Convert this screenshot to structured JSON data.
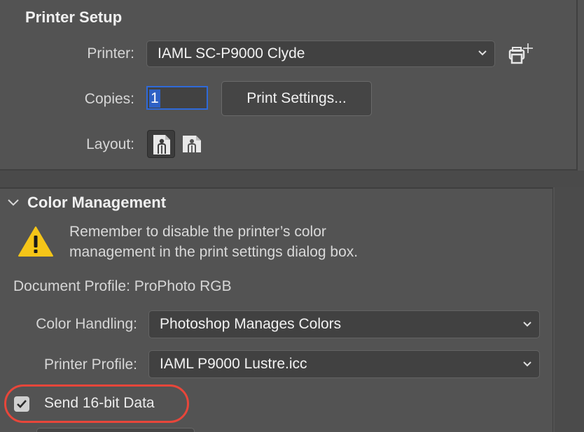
{
  "printer_setup": {
    "title": "Printer Setup",
    "printer_label": "Printer:",
    "printer_value": "IAML SC-P9000 Clyde",
    "copies_label": "Copies:",
    "copies_value": "1",
    "print_settings_button": "Print Settings...",
    "layout_label": "Layout:",
    "layout_options": [
      "portrait-layout-icon",
      "landscape-layout-icon"
    ],
    "layout_selected": "portrait"
  },
  "color_management": {
    "title": "Color Management",
    "warning": "Remember to disable the printer’s color management in the print settings dialog box.",
    "warning_line1": "Remember to disable the printer’s color",
    "warning_line2": "management in the print settings dialog box.",
    "document_profile": "Document Profile: ProPhoto RGB",
    "color_handling_label": "Color Handling:",
    "color_handling_value": "Photoshop Manages Colors",
    "printer_profile_label": "Printer Profile:",
    "printer_profile_value": "IAML P9000 Lustre.icc",
    "send_16bit_label": "Send 16-bit Data",
    "send_16bit_checked": true
  },
  "colors": {
    "highlight": "#e8463a",
    "focus": "#2f6ad9",
    "warning_yellow": "#f5c518"
  }
}
